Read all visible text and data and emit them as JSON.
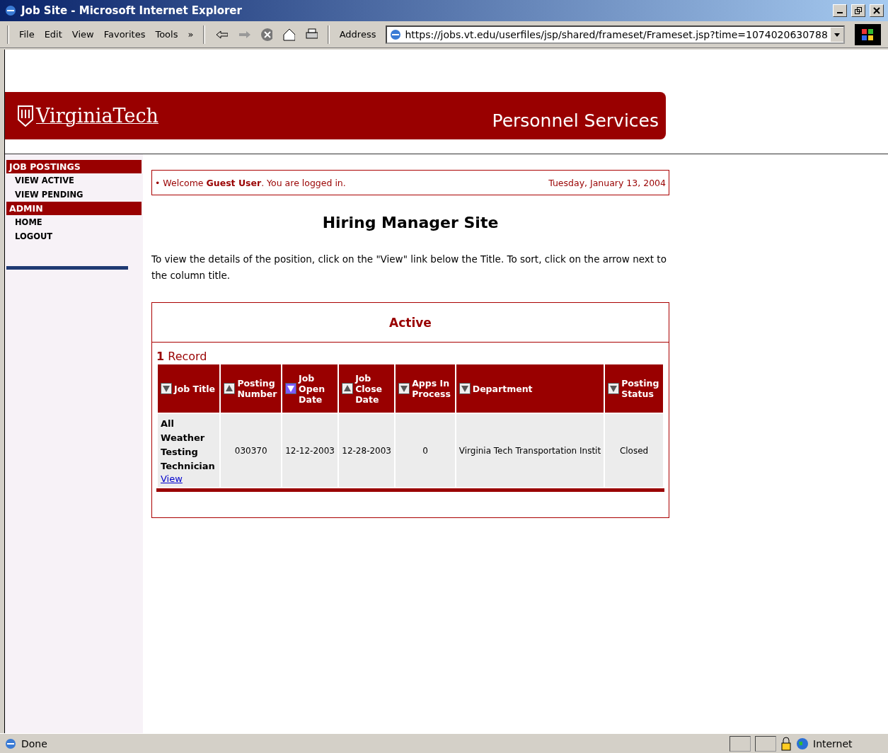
{
  "window": {
    "title": "Job Site - Microsoft Internet Explorer"
  },
  "menu": [
    "File",
    "Edit",
    "View",
    "Favorites",
    "Tools"
  ],
  "menu_overflow": "»",
  "address": {
    "label": "Address",
    "value": "https://jobs.vt.edu/userfiles/jsp/shared/frameset/Frameset.jsp?time=1074020630788"
  },
  "banner": {
    "logo": "VirginiaTech",
    "title": "Personnel Services"
  },
  "sidebar": [
    {
      "heading": "JOB POSTINGS",
      "items": [
        "VIEW ACTIVE",
        "VIEW PENDING"
      ]
    },
    {
      "heading": "ADMIN",
      "items": [
        "HOME",
        "LOGOUT"
      ]
    }
  ],
  "welcome": {
    "bullet": "•",
    "text": "Welcome **Guest User**. You are logged in.",
    "date": "Tuesday, January 13, 2004"
  },
  "heading": "Hiring Manager Site",
  "instructions": "To view the details of the position, click on the \"View\" link below the Title. To sort, click on the arrow next to the column title.",
  "panel_title": "Active",
  "record_count": "**1** Record",
  "table": {
    "columns": [
      {
        "label": "Job Title",
        "ascending": false,
        "selected": false
      },
      {
        "label": "Posting Number",
        "ascending": true,
        "selected": false
      },
      {
        "label": "Job Open Date",
        "ascending": false,
        "selected": true
      },
      {
        "label": "Job Close Date",
        "ascending": true,
        "selected": false
      },
      {
        "label": "Apps In Process",
        "ascending": false,
        "selected": false
      },
      {
        "label": "Department",
        "ascending": false,
        "selected": false
      },
      {
        "label": "Posting Status",
        "ascending": false,
        "selected": false
      }
    ],
    "rows": [
      {
        "link": "View",
        "cells": [
          "All Weather Testing Technician",
          "030370",
          "12-12-2003",
          "12-28-2003",
          "0",
          "Virginia Tech Transportation Instit",
          "Closed"
        ]
      }
    ]
  },
  "status_bar": {
    "text": "Done",
    "zone": "Internet"
  }
}
